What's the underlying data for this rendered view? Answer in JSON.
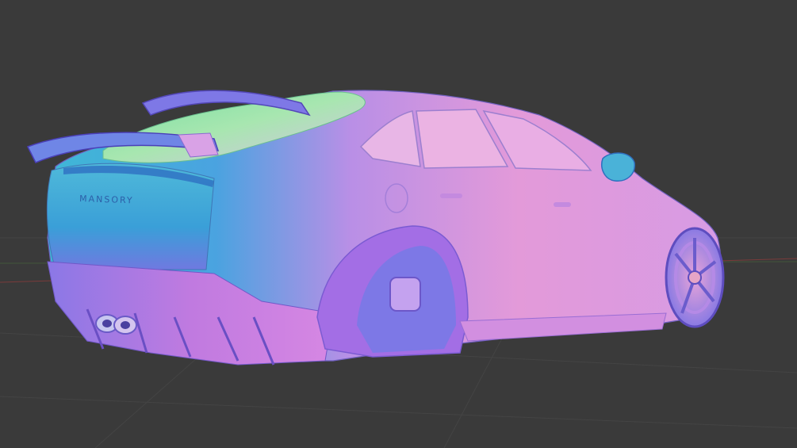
{
  "viewport": {
    "background": "#3a3a3a",
    "grid_color": "#444444",
    "axis_x_color": "#7a3a3a",
    "axis_y_color": "#4a6a3a"
  },
  "object": {
    "kind": "car-model",
    "shading": "normal-map",
    "rear_badge_text": "MANSORY"
  }
}
